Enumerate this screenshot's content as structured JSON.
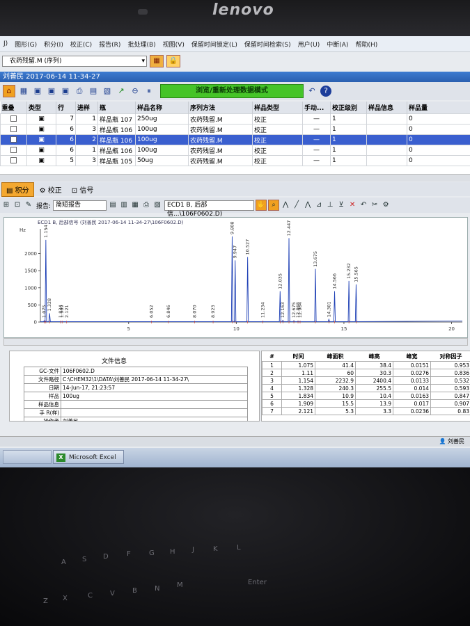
{
  "laptop": {
    "brand": "lenovo"
  },
  "menubar": [
    "J)",
    "图形(G)",
    "积分(I)",
    "校正(C)",
    "报告(R)",
    "批处理(B)",
    "视图(V)",
    "保留时间锁定(L)",
    "保留时间检索(S)",
    "用户(U)",
    "中断(A)",
    "帮助(H)"
  ],
  "sequence": {
    "name": "农药残留.M (序列)"
  },
  "window_title": "刘善民 2017-06-14 11-34-27",
  "mode_banner": "浏览/重新处理数据模式",
  "seq_table": {
    "headers": [
      "重叠",
      "类型",
      "行",
      "进样",
      "瓶",
      "样品名称",
      "序列方法",
      "样品类型",
      "手动...",
      "校正级别",
      "样品信息",
      "样品量"
    ],
    "rows": [
      {
        "row": "7",
        "inj": "1",
        "vial": "样品瓶 107",
        "name": "250ug",
        "method": "农药残留.M",
        "type": "校正",
        "manual": "—",
        "level": "1",
        "info": "",
        "amount": "0",
        "selected": false
      },
      {
        "row": "6",
        "inj": "3",
        "vial": "样品瓶 106",
        "name": "100ug",
        "method": "农药残留.M",
        "type": "校正",
        "manual": "—",
        "level": "1",
        "info": "",
        "amount": "0",
        "selected": false
      },
      {
        "row": "6",
        "inj": "2",
        "vial": "样品瓶 106",
        "name": "100ug",
        "method": "农药残留.M",
        "type": "校正",
        "manual": "—",
        "level": "1",
        "info": "",
        "amount": "0",
        "selected": true
      },
      {
        "row": "6",
        "inj": "1",
        "vial": "样品瓶 106",
        "name": "100ug",
        "method": "农药残留.M",
        "type": "校正",
        "manual": "—",
        "level": "1",
        "info": "",
        "amount": "0",
        "selected": false
      },
      {
        "row": "5",
        "inj": "3",
        "vial": "样品瓶 105",
        "name": "50ug",
        "method": "农药残留.M",
        "type": "校正",
        "manual": "—",
        "level": "1",
        "info": "",
        "amount": "0",
        "selected": false
      }
    ]
  },
  "tabs": [
    "积分",
    "校正",
    "信号"
  ],
  "report": {
    "label": "报告:",
    "value": "简短报告"
  },
  "signal_select": "ECD1 B, 后部信...\\106F0602.D)",
  "chart_data": {
    "type": "line",
    "title": "ECD1 B, 后部信号 (刘善民 2017-06-14 11-34-27\\106F0602.D)",
    "ylabel": "Hz",
    "y_ticks": [
      "0",
      "500",
      "1000",
      "1500",
      "2000"
    ],
    "x_ticks": [
      "5",
      "10",
      "15",
      "20"
    ],
    "xlim": [
      0.9,
      20.5
    ],
    "ylim": [
      0,
      2600
    ],
    "baseline": 10,
    "peaks": [
      {
        "t": 1.075,
        "h": 38.4,
        "label": "1.075"
      },
      {
        "t": 1.11,
        "h": 30.3,
        "label": ""
      },
      {
        "t": 1.154,
        "h": 2400.4,
        "label": "1.154"
      },
      {
        "t": 1.328,
        "h": 255.5,
        "label": "1.328"
      },
      {
        "t": 1.834,
        "h": 10.4,
        "label": "1.834"
      },
      {
        "t": 1.909,
        "h": 13.9,
        "label": "1.909"
      },
      {
        "t": 2.121,
        "h": 3.3,
        "label": "2.121"
      },
      {
        "t": 6.052,
        "h": 15,
        "label": "6.052"
      },
      {
        "t": 6.846,
        "h": 12,
        "label": "6.846"
      },
      {
        "t": 8.07,
        "h": 10,
        "label": "8.070"
      },
      {
        "t": 8.923,
        "h": 12,
        "label": "8.923"
      },
      {
        "t": 9.808,
        "h": 2500,
        "label": "9.808"
      },
      {
        "t": 9.947,
        "h": 1800,
        "label": "9.947"
      },
      {
        "t": 10.527,
        "h": 1900,
        "label": "10.527"
      },
      {
        "t": 11.234,
        "h": 20,
        "label": "11.234"
      },
      {
        "t": 12.035,
        "h": 900,
        "label": "12.035"
      },
      {
        "t": 12.163,
        "h": 50,
        "label": "12.163"
      },
      {
        "t": 12.447,
        "h": 2450,
        "label": "12.447"
      },
      {
        "t": 12.675,
        "h": 40,
        "label": "12.675"
      },
      {
        "t": 12.868,
        "h": 30,
        "label": "12.868"
      },
      {
        "t": 12.964,
        "h": 20,
        "label": "12.964"
      },
      {
        "t": 13.675,
        "h": 1550,
        "label": "13.675"
      },
      {
        "t": 14.301,
        "h": 80,
        "label": "14.301"
      },
      {
        "t": 14.566,
        "h": 900,
        "label": "14.566"
      },
      {
        "t": 15.232,
        "h": 1200,
        "label": "15.232"
      },
      {
        "t": 15.565,
        "h": 1100,
        "label": "15.565"
      }
    ]
  },
  "file_info": {
    "title": "文件信息",
    "rows": [
      {
        "k": "GC-文件",
        "v": "106F0602.D"
      },
      {
        "k": "文件路径",
        "v": "C:\\CHEM32\\1\\DATA\\刘善民 2017-06-14 11-34-27\\"
      },
      {
        "k": "日期",
        "v": "14-Jun-17, 21:23:57"
      },
      {
        "k": "样品",
        "v": "100ug"
      },
      {
        "k": "样品信息",
        "v": ""
      },
      {
        "k": "手 R(样)",
        "v": ""
      },
      {
        "k": "操作者",
        "v": "刘善民"
      }
    ]
  },
  "peak_table": {
    "headers": [
      "#",
      "时间",
      "峰面积",
      "峰高",
      "峰宽",
      "对称因子"
    ],
    "rows": [
      [
        "1",
        "1.075",
        "41.4",
        "38.4",
        "0.0151",
        "0.953"
      ],
      [
        "2",
        "1.11",
        "60",
        "30.3",
        "0.0276",
        "0.836"
      ],
      [
        "3",
        "1.154",
        "2232.9",
        "2400.4",
        "0.0133",
        "0.532"
      ],
      [
        "4",
        "1.328",
        "240.3",
        "255.5",
        "0.014",
        "0.593"
      ],
      [
        "5",
        "1.834",
        "10.9",
        "10.4",
        "0.0163",
        "0.847"
      ],
      [
        "6",
        "1.909",
        "15.5",
        "13.9",
        "0.017",
        "0.907"
      ],
      [
        "7",
        "2.121",
        "5.3",
        "3.3",
        "0.0236",
        "0.83"
      ]
    ]
  },
  "status_user": "刘善民",
  "taskbar": {
    "excel": "Microsoft Excel"
  },
  "keyboard_keys": [
    "A",
    "S",
    "D",
    "F",
    "G",
    "H",
    "J",
    "K",
    "L",
    "Z",
    "X",
    "C",
    "V",
    "B",
    "N",
    "M",
    "Enter"
  ]
}
